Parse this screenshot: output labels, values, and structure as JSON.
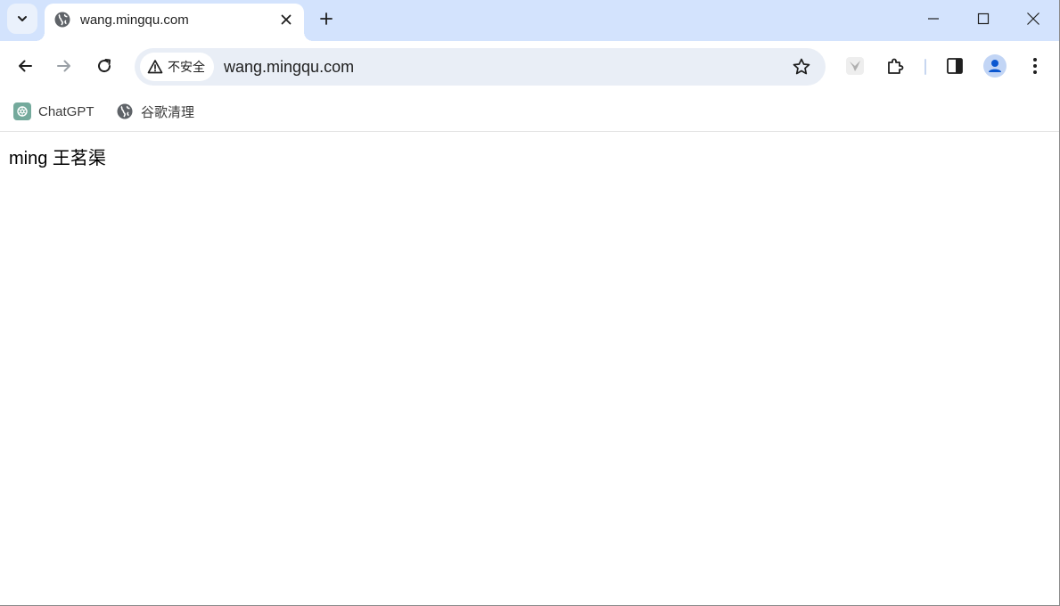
{
  "tab": {
    "title": "wang.mingqu.com"
  },
  "omnibox": {
    "security_label": "不安全",
    "url": "wang.mingqu.com"
  },
  "bookmarks": [
    {
      "label": "ChatGPT",
      "icon": "chatgpt-icon"
    },
    {
      "label": "谷歌清理",
      "icon": "globe-icon"
    }
  ],
  "page": {
    "text": "ming 王茗渠"
  },
  "colors": {
    "tabstrip_bg": "#d3e3fd",
    "omnibox_bg": "#e9eef6",
    "avatar_bg": "#c2d5f5",
    "avatar_fg": "#0b57d0",
    "chatgpt_bg": "#74aa9c"
  }
}
